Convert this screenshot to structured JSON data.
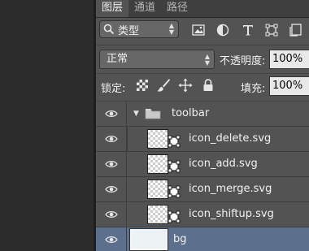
{
  "tabs": [
    {
      "label": "图层",
      "active": true
    },
    {
      "label": "通道",
      "active": false
    },
    {
      "label": "路径",
      "active": false
    }
  ],
  "filter": {
    "kind_label": "类型",
    "icons": [
      "image-filter-icon",
      "adjustment-filter-icon",
      "type-filter-icon",
      "shape-filter-icon",
      "smart-object-filter-icon"
    ]
  },
  "blend": {
    "mode": "正常",
    "opacity_label": "不透明度:",
    "opacity_value": "100%"
  },
  "lock": {
    "label": "锁定:",
    "icons": [
      "lock-transparent-icon",
      "lock-image-icon",
      "lock-position-icon",
      "lock-all-icon"
    ],
    "fill_label": "填充:",
    "fill_value": "100%"
  },
  "layers": [
    {
      "name": "toolbar",
      "type": "group",
      "expanded": true,
      "selected": false,
      "visible": true
    },
    {
      "name": "icon_delete.svg",
      "type": "smart-object",
      "selected": false,
      "visible": true
    },
    {
      "name": "icon_add.svg",
      "type": "smart-object",
      "selected": false,
      "visible": true
    },
    {
      "name": "icon_merge.svg",
      "type": "smart-object",
      "selected": false,
      "visible": true
    },
    {
      "name": "icon_shiftup.svg",
      "type": "smart-object",
      "selected": false,
      "visible": true
    },
    {
      "name": "bg",
      "type": "layer",
      "selected": true,
      "visible": true
    }
  ],
  "colors": {
    "panel": "#535353",
    "selected_row": "#5c6f8c",
    "tab_bar": "#3f3f3f"
  }
}
